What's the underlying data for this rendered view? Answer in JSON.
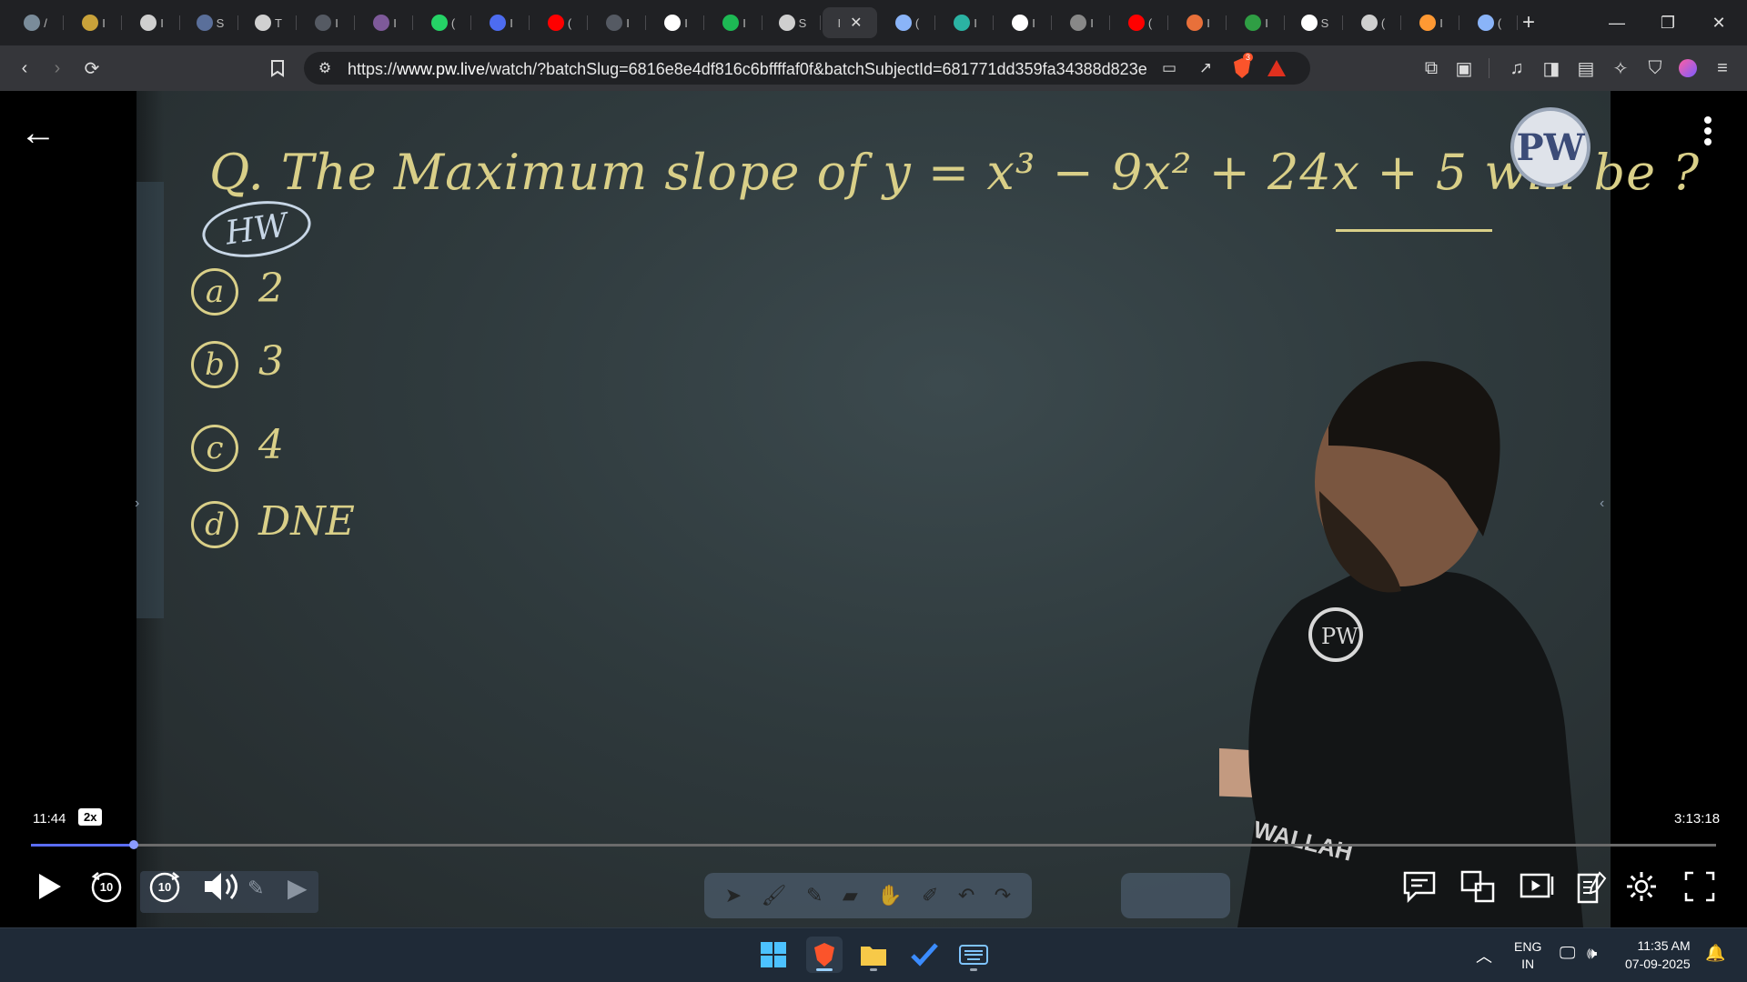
{
  "browser": {
    "tabs": [
      {
        "label": "/",
        "color": "#7a8c9a"
      },
      {
        "label": "I",
        "color": "#c9a23a"
      },
      {
        "label": "I",
        "color": "#cfcfcf"
      },
      {
        "label": "S",
        "color": "#5a6f9a"
      },
      {
        "label": "T",
        "color": "#d0d0d0"
      },
      {
        "label": "I",
        "color": "#555a63"
      },
      {
        "label": "I",
        "color": "#7e5a9a"
      },
      {
        "label": "(",
        "color": "#25d366"
      },
      {
        "label": "I",
        "color": "#4d6cf0"
      },
      {
        "label": "(",
        "color": "#ff0000"
      },
      {
        "label": "I",
        "color": "#555a63"
      },
      {
        "label": "I",
        "color": "#ffffff"
      },
      {
        "label": "I",
        "color": "#1db954"
      },
      {
        "label": "S",
        "color": "#cfcfcf"
      },
      {
        "label": "I",
        "color": "#35363a",
        "active": true
      },
      {
        "label": "(",
        "color": "#8ab4f8"
      },
      {
        "label": "I",
        "color": "#2bb3a3"
      },
      {
        "label": "I",
        "color": "#ffffff"
      },
      {
        "label": "I",
        "color": "#888888"
      },
      {
        "label": "(",
        "color": "#ff0000"
      },
      {
        "label": "I",
        "color": "#e8703a"
      },
      {
        "label": "I",
        "color": "#2f9e44"
      },
      {
        "label": "S",
        "color": "#ffffff"
      },
      {
        "label": "(",
        "color": "#cfcfcf"
      },
      {
        "label": "I",
        "color": "#ff9933"
      },
      {
        "label": "(",
        "color": "#8ab4f8"
      }
    ],
    "active_tab_close": "✕",
    "new_tab": "+",
    "url_prefix": "https://",
    "url_domain": "www.pw.live",
    "url_rest": "/watch/?batchSlug=6816e8e4df816c6bffffaf0f&batchSubjectId=681771dd359fa34388d823e...",
    "brave_badge": "3"
  },
  "board": {
    "question": "Q. The Maximum slope of y = x³ − 9x² + 24x + 5 will be ?",
    "hw": "HW",
    "options": [
      {
        "letter": "a",
        "text": "2"
      },
      {
        "letter": "b",
        "text": "3"
      },
      {
        "letter": "c",
        "text": "4"
      },
      {
        "letter": "d",
        "text": "DNE"
      }
    ],
    "logo_text": "PW",
    "shirt_text": "WALLAH"
  },
  "player": {
    "current_time": "11:44",
    "speed": "2x",
    "total_time": "3:13:18",
    "progress": 0.061,
    "rewind_label": "10",
    "forward_label": "10"
  },
  "taskbar": {
    "lang_line1": "ENG",
    "lang_line2": "IN",
    "time": "11:35 AM",
    "date": "07-09-2025"
  },
  "colors": {
    "chalk": "#d9cf88",
    "hw_circle": "#c7d6e6",
    "accent": "#5b6dff"
  }
}
